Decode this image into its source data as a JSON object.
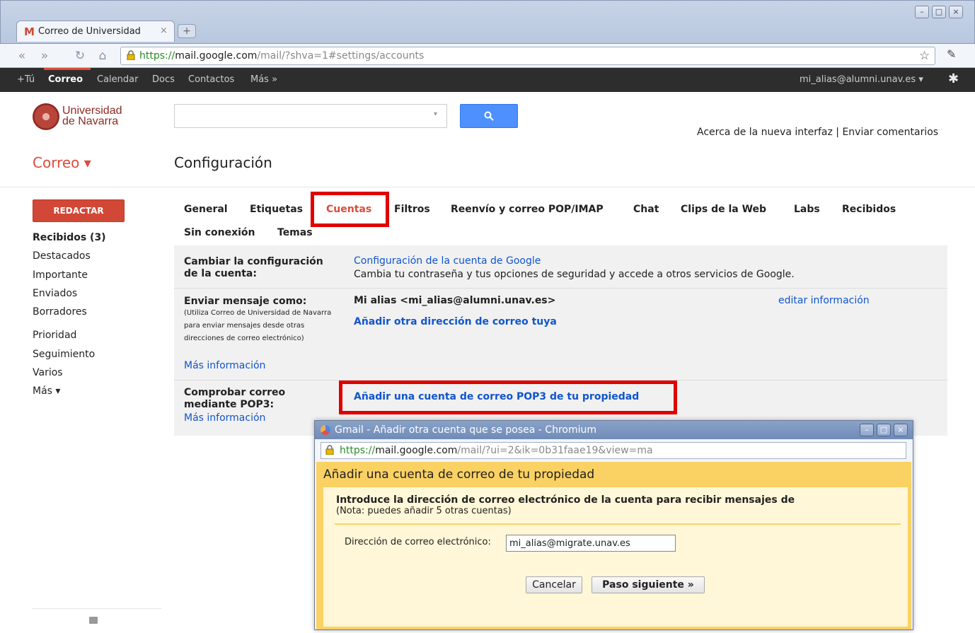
{
  "browser": {
    "tab_title": "Correo de Universidad",
    "tab_close": "×",
    "new_tab": "+",
    "url_scheme": "https://",
    "url_host": "mail.google.com",
    "url_path": "/mail/?shva=1#settings/accounts",
    "window_buttons": [
      "–",
      "□",
      "×"
    ]
  },
  "gbar": {
    "items": [
      "+Tú",
      "Correo",
      "Calendar",
      "Docs",
      "Contactos",
      "Más »"
    ],
    "account": "mi_alias@alumni.unav.es ▾"
  },
  "header": {
    "logo_line1": "Universidad",
    "logo_line2": "de Navarra",
    "links": "Acerca de la nueva interfaz | Enviar comentarios",
    "app_title": "Correo ▾",
    "page_title": "Configuración"
  },
  "sidebar": {
    "compose": "REDACTAR",
    "items": [
      "Recibidos (3)",
      "Destacados",
      "Importante",
      "Enviados",
      "Borradores",
      "Prioridad",
      "Seguimiento",
      "Varios",
      "Más ▾"
    ]
  },
  "settings_tabs": [
    "General",
    "Etiquetas",
    "Cuentas",
    "Filtros",
    "Reenvío y correo POP/IMAP",
    "Chat",
    "Clips de la Web",
    "Labs",
    "Recibidos",
    "Sin conexión",
    "Temas"
  ],
  "rows": {
    "account": {
      "label_l1": "Cambiar la configuración",
      "label_l2": "de la cuenta:",
      "link": "Configuración de la cuenta de Google",
      "desc": "Cambia tu contraseña y tus opciones de seguridad y accede a otros servicios de Google."
    },
    "send_as": {
      "label": "Enviar mensaje como:",
      "note": "(Utiliza Correo de Universidad de Navarra para enviar mensajes desde otras direcciones de correo electrónico)",
      "more": "Más información",
      "identity": "Mi alias <mi_alias@alumni.unav.es>",
      "edit": "editar información",
      "add": "Añadir otra dirección de correo tuya"
    },
    "pop3": {
      "label_l1": "Comprobar correo",
      "label_l2": "mediante POP3:",
      "more": "Más información",
      "add": "Añadir una cuenta de correo POP3 de tu propiedad"
    }
  },
  "popup": {
    "title": "Gmail - Añadir otra cuenta que se posea - Chromium",
    "url_scheme": "https://",
    "url_host": "mail.google.com",
    "url_path": "/mail/?ui=2&ik=0b31faae19&view=ma",
    "heading": "Añadir una cuenta de correo de tu propiedad",
    "intro": "Introduce la dirección de correo electrónico de la cuenta para recibir mensajes de",
    "note": "(Nota: puedes añadir 5 otras cuentas)",
    "email_label": "Dirección de correo electrónico:",
    "email_value": "mi_alias@migrate.unav.es",
    "cancel": "Cancelar",
    "next": "Paso siguiente »"
  }
}
